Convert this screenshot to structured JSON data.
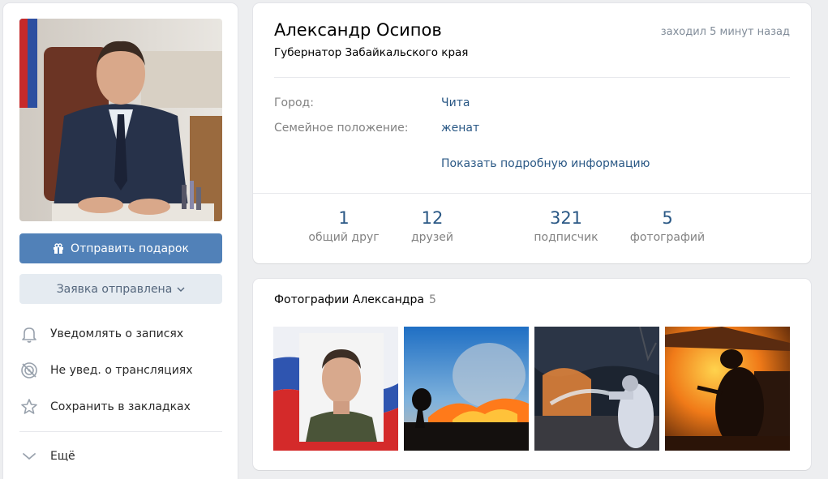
{
  "profile": {
    "name": "Александр Осипов",
    "status": "Губернатор Забайкальского края",
    "online": "заходил 5 минут назад"
  },
  "info": {
    "rows": [
      {
        "label": "Город:",
        "value": "Чита"
      },
      {
        "label": "Семейное положение:",
        "value": "женат"
      }
    ],
    "more_link": "Показать подробную информацию"
  },
  "counters": [
    {
      "value": "1",
      "caption": "общий друг"
    },
    {
      "value": "12",
      "caption": "друзей"
    },
    {
      "value": "321",
      "caption": "подписчик"
    },
    {
      "value": "5",
      "caption": "фотографий"
    }
  ],
  "actions": {
    "gift_label": "Отправить подарок",
    "request_label": "Заявка отправлена"
  },
  "menu": {
    "items": [
      {
        "label": "Уведомлять о записях",
        "icon": "bell-icon"
      },
      {
        "label": "Не увед. о трансляциях",
        "icon": "broadcast-off-icon"
      },
      {
        "label": "Сохранить в закладках",
        "icon": "star-icon"
      },
      {
        "label": "Ещё",
        "icon": "chevron-down-icon"
      }
    ]
  },
  "photos": {
    "title": "Фотографии Александра",
    "count": "5"
  },
  "colors": {
    "accent": "#5181b8",
    "link": "#2a5885",
    "secondary_button": "#e5ebf1",
    "background": "#edeef0"
  }
}
